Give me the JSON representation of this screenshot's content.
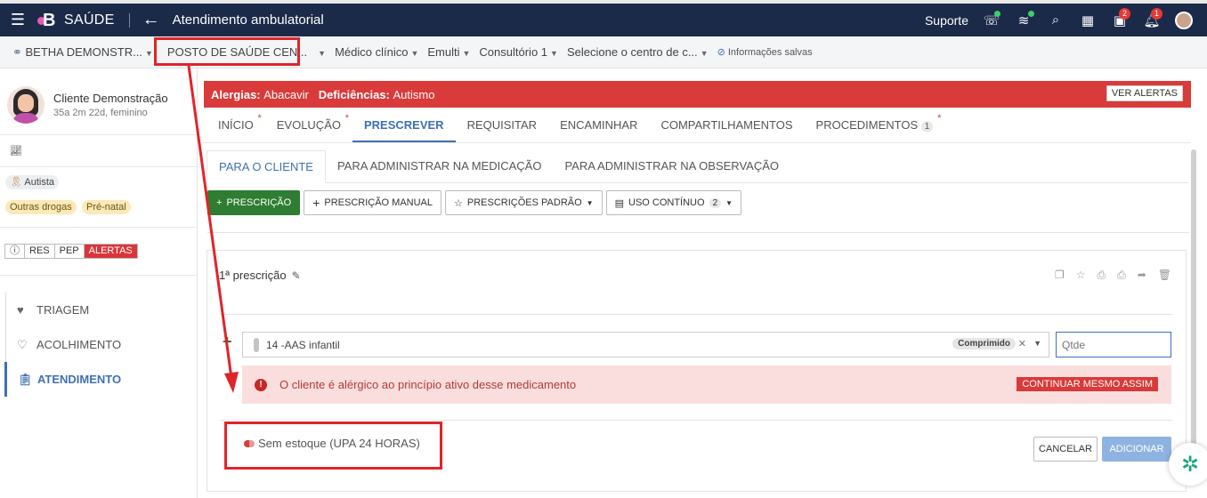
{
  "topbar": {
    "app_name": "SAÚDE",
    "title": "Atendimento ambulatorial",
    "support": "Suporte",
    "gifts_badge": "2",
    "notif_badge": "1"
  },
  "context": {
    "entity": "BETHA DEMONSTR...",
    "unit": "POSTO DE SAÚDE CEN...",
    "role": "Médico clínico",
    "team": "Emulti",
    "room": "Consultório 1",
    "center": "Selecione o centro de c...",
    "saved": "Informações salvas"
  },
  "patient": {
    "name": "Cliente Demonstração",
    "sub": "35a 2m 22d, feminino",
    "tag_autista": "Autista",
    "tag_drogas": "Outras drogas",
    "tag_prenatal": "Pré-natal",
    "btns": [
      "ⓘ",
      "RES",
      "PEP",
      "ALERTAS"
    ]
  },
  "nav": {
    "triagem": "TRIAGEM",
    "acolhimento": "ACOLHIMENTO",
    "atendimento": "ATENDIMENTO"
  },
  "alert": {
    "allergy_label": "Alergias:",
    "allergy_value": "Abacavir",
    "def_label": "Deficiências:",
    "def_value": "Autismo",
    "ver": "VER ALERTAS"
  },
  "tabs": {
    "inicio": "INÍCIO",
    "evolucao": "EVOLUÇÃO",
    "prescrever": "PRESCREVER",
    "requisitar": "REQUISITAR",
    "encaminhar": "ENCAMINHAR",
    "compart": "COMPARTILHAMENTOS",
    "proc": "PROCEDIMENTOS",
    "proc_count": "1"
  },
  "subtabs": {
    "cliente": "PARA O CLIENTE",
    "medicacao": "PARA ADMINISTRAR NA MEDICAÇÃO",
    "observacao": "PARA ADMINISTRAR NA OBSERVAÇÃO"
  },
  "toolbar": {
    "prescricao": "PRESCRIÇÃO",
    "manual": "PRESCRIÇÃO MANUAL",
    "padrao": "PRESCRIÇÕES PADRÃO",
    "continuo": "USO CONTÍNUO",
    "continuo_count": "2"
  },
  "prescription": {
    "title": "1ª prescrição",
    "medication": "14 -AAS infantil",
    "form": "Comprimido",
    "qty_placeholder": "Qtde",
    "warning": "O cliente é alérgico ao princípio ativo desse medicamento",
    "continue": "CONTINUAR MESMO ASSIM",
    "stock": "Sem estoque (UPA 24 HORAS)",
    "cancel": "CANCELAR",
    "add": "ADICIONAR"
  },
  "colors": {
    "header": "#1b2a49",
    "alert": "#d93a3a",
    "accent": "#3f6fb5",
    "green": "#2e7d32",
    "annotation": "#e0242a"
  }
}
